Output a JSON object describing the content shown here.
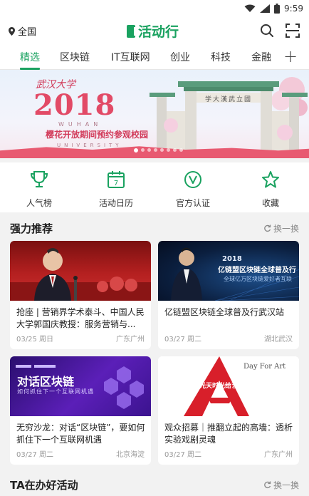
{
  "status": {
    "time": "9:59"
  },
  "header": {
    "location": "全国",
    "brand": "活动行",
    "colors": {
      "brand": "#1aa260",
      "accent": "#e24a66"
    },
    "icons": [
      "location-pin-icon",
      "search-icon",
      "scan-icon"
    ]
  },
  "tabs": [
    {
      "label": "精选",
      "active": true
    },
    {
      "label": "区块链"
    },
    {
      "label": "IT互联网"
    },
    {
      "label": "创业"
    },
    {
      "label": "科技"
    },
    {
      "label": "金融"
    }
  ],
  "banner": {
    "script": "武汉大学",
    "year": "2018",
    "sub_en": "WUHAN",
    "title": "樱花开放期间预约参观校园",
    "univ_en": "UNIVERSITY",
    "gate_text": "学大漢武立國",
    "dots": 8,
    "active_dot": 0
  },
  "quicknav": [
    {
      "label": "人气榜",
      "icon": "trophy-icon"
    },
    {
      "label": "活动日历",
      "icon": "calendar-icon",
      "day": "7"
    },
    {
      "label": "官方认证",
      "icon": "verified-icon"
    },
    {
      "label": "收藏",
      "icon": "star-icon"
    }
  ],
  "recommend": {
    "title": "强力推荐",
    "refresh": "换一换",
    "cards": [
      {
        "title": "抢座 | 营销界学术泰斗、中国人民大学郭国庆教授：服务营销与...",
        "date": "03/25 周日",
        "location": "广东广州",
        "image_desc": "speaker-photo"
      },
      {
        "title": "亿链盟区块链全球普及行武汉站",
        "date": "03/27 周二",
        "location": "湖北武汉",
        "image_year": "2018",
        "image_head": "亿链盟区块链全球普及行",
        "image_sub": "全球亿万区块链爱好者互联"
      },
      {
        "title": "无穷沙龙：对话“区块链”，要如何抓住下一个互联网机遇",
        "date": "03/27 周二",
        "location": "北京海淀",
        "image_head": "对话区块链",
        "image_sub": "如何抓住下一个互联网机遇"
      },
      {
        "title": "观众招募｜推翻立起的高墙：透析实验戏剧灵魂",
        "date": "03/27 周二",
        "location": "广东广州",
        "image_head": "Day For Art",
        "image_sub": "光天时光给艺术"
      }
    ]
  },
  "ta_section": {
    "title": "TA在办好活动",
    "refresh": "换一换"
  }
}
